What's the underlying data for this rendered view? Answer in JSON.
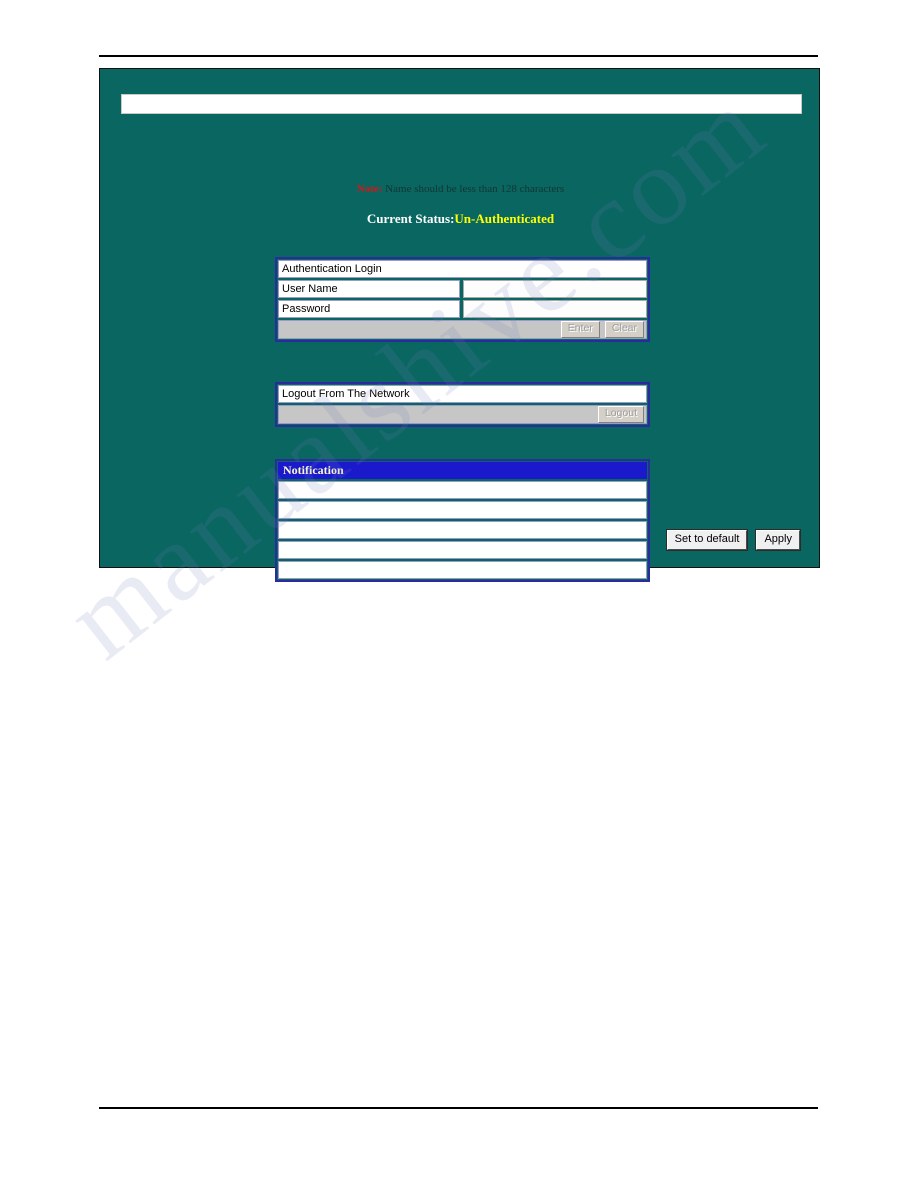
{
  "page": {
    "background_color": "#ffffff",
    "panel_color": "#0a6661",
    "accent_border_color": "#2b2b9e",
    "notification_header_color": "#1a1acc",
    "status_value_color": "#ffff00",
    "note_label_color": "#d01818",
    "watermark_text": "manualshive.com"
  },
  "top_field": {
    "value": "",
    "placeholder": ""
  },
  "note": {
    "label": "Note:",
    "text": "Name should be less than 128 characters"
  },
  "status": {
    "label": "Current Status:",
    "value": "Un-Authenticated"
  },
  "auth_login": {
    "title": "Authentication Login",
    "fields": [
      {
        "label": "User Name",
        "value": ""
      },
      {
        "label": "Password",
        "value": ""
      }
    ],
    "buttons": [
      {
        "label": "Enter"
      },
      {
        "label": "Clear"
      }
    ]
  },
  "logout": {
    "title": "Logout From The Network",
    "buttons": [
      {
        "label": "Logout"
      }
    ]
  },
  "notification": {
    "header": "Notification",
    "rows": [
      {
        "value": ""
      },
      {
        "value": ""
      },
      {
        "value": ""
      },
      {
        "value": ""
      },
      {
        "value": ""
      }
    ]
  },
  "actions": {
    "set_default_label": "Set to default",
    "apply_label": "Apply"
  }
}
